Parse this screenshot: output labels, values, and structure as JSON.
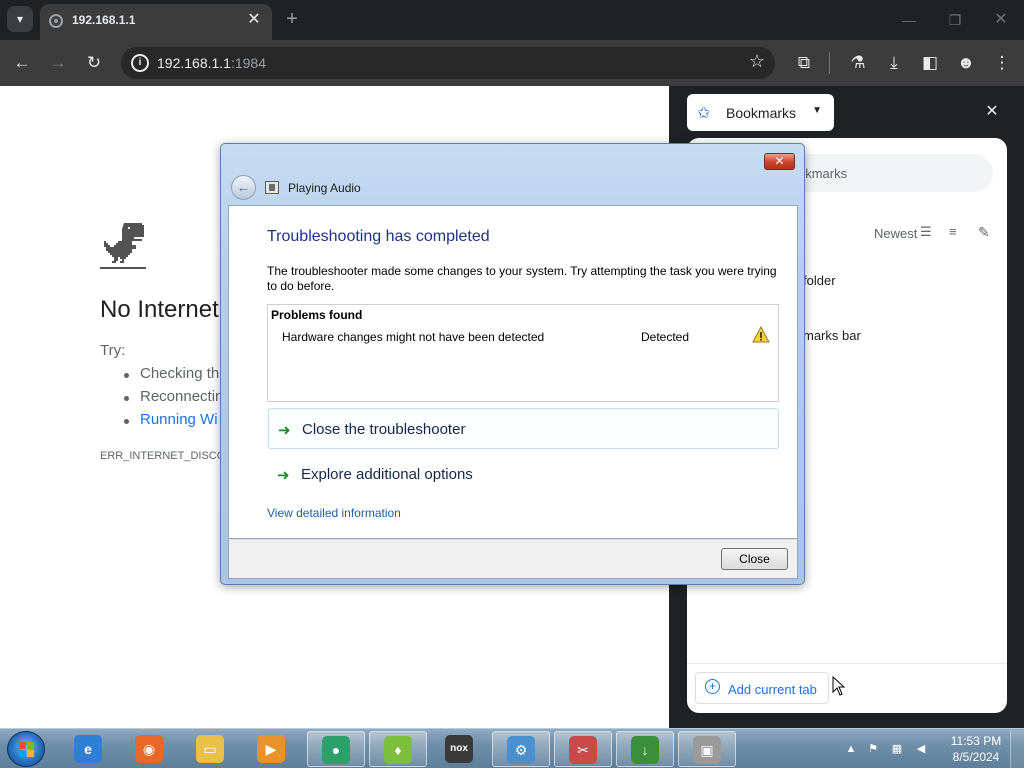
{
  "browser": {
    "tab": {
      "title": "192.168.1.1"
    },
    "url": {
      "host": "192.168.1.1",
      "port": ":1984"
    }
  },
  "page": {
    "heading": "No Internet",
    "try_label": "Try:",
    "suggestions": [
      "Checking the",
      "Reconnectin",
      "Running Wi"
    ],
    "error_code": "ERR_INTERNET_DISCO"
  },
  "side_panel": {
    "dropdown_label": "Bookmarks",
    "search_placeholder": "okmarks",
    "sort_label": "Newest",
    "folders": [
      "folder",
      "marks bar"
    ],
    "add_button": "Add current tab"
  },
  "dialog": {
    "title": "Playing Audio",
    "close_glyph": "✕",
    "heading": "Troubleshooting has completed",
    "description": "The troubleshooter made some changes to your system. Try attempting the task you were trying to do before.",
    "problems_header": "Problems found",
    "problem": {
      "name": "Hardware changes might not have been detected",
      "status": "Detected"
    },
    "commands": [
      "Close the troubleshooter",
      "Explore additional options"
    ],
    "details_link": "View detailed information",
    "close_button": "Close"
  },
  "taskbar": {
    "apps": [
      {
        "name": "internet-explorer",
        "glyph": "e",
        "color": "#2f7fd6",
        "running": false
      },
      {
        "name": "firefox",
        "glyph": "◉",
        "color": "#e8682a",
        "running": false
      },
      {
        "name": "explorer",
        "glyph": "▭",
        "color": "#e8c04a",
        "running": false
      },
      {
        "name": "media-player",
        "glyph": "▶",
        "color": "#e8932a",
        "running": false
      },
      {
        "name": "chrome",
        "glyph": "●",
        "color": "#2aa06a",
        "running": true
      },
      {
        "name": "android",
        "glyph": "♦",
        "color": "#7cbf3a",
        "running": true
      },
      {
        "name": "nox",
        "glyph": "nox",
        "color": "#3a3a3a",
        "running": false
      },
      {
        "name": "network-tool",
        "glyph": "⚙",
        "color": "#4b8fcf",
        "running": true
      },
      {
        "name": "snipping-tool",
        "glyph": "✂",
        "color": "#c94a4a",
        "running": true
      },
      {
        "name": "download-manager",
        "glyph": "↓",
        "color": "#3b8f3b",
        "running": true
      },
      {
        "name": "troubleshooter",
        "glyph": "▣",
        "color": "#9a9a9a",
        "running": true
      }
    ],
    "clock": {
      "time": "11:53 PM",
      "date": "8/5/2024"
    }
  }
}
